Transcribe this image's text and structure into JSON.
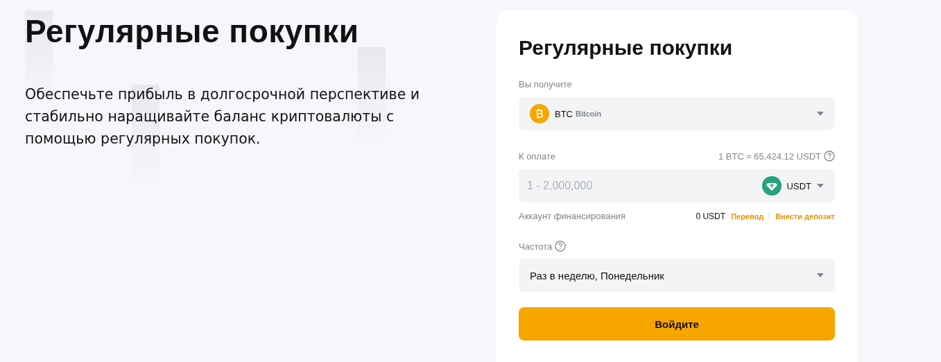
{
  "hero": {
    "title": "Регулярные покупки",
    "description": "Обеспечьте прибыль в долгосрочной перспективе и стабильно наращивайте баланс криптовалюты с помощью регулярных покупок."
  },
  "form": {
    "title": "Регулярные покупки",
    "receive": {
      "label": "Вы получите",
      "symbol": "BTC",
      "name": "Bitcoin"
    },
    "pay": {
      "label": "К оплате",
      "rate": "1 BTC ≈ 65,424.12 USDT",
      "placeholder": "1 - 2,000,000",
      "currency": "USDT"
    },
    "funding": {
      "label": "Аккаунт финансирования",
      "balance": "0 USDT",
      "links": [
        "Перевод",
        "Внести депозит"
      ]
    },
    "frequency": {
      "label": "Частота",
      "value": "Раз в неделю, Понедельник"
    },
    "submit": "Войдите"
  }
}
